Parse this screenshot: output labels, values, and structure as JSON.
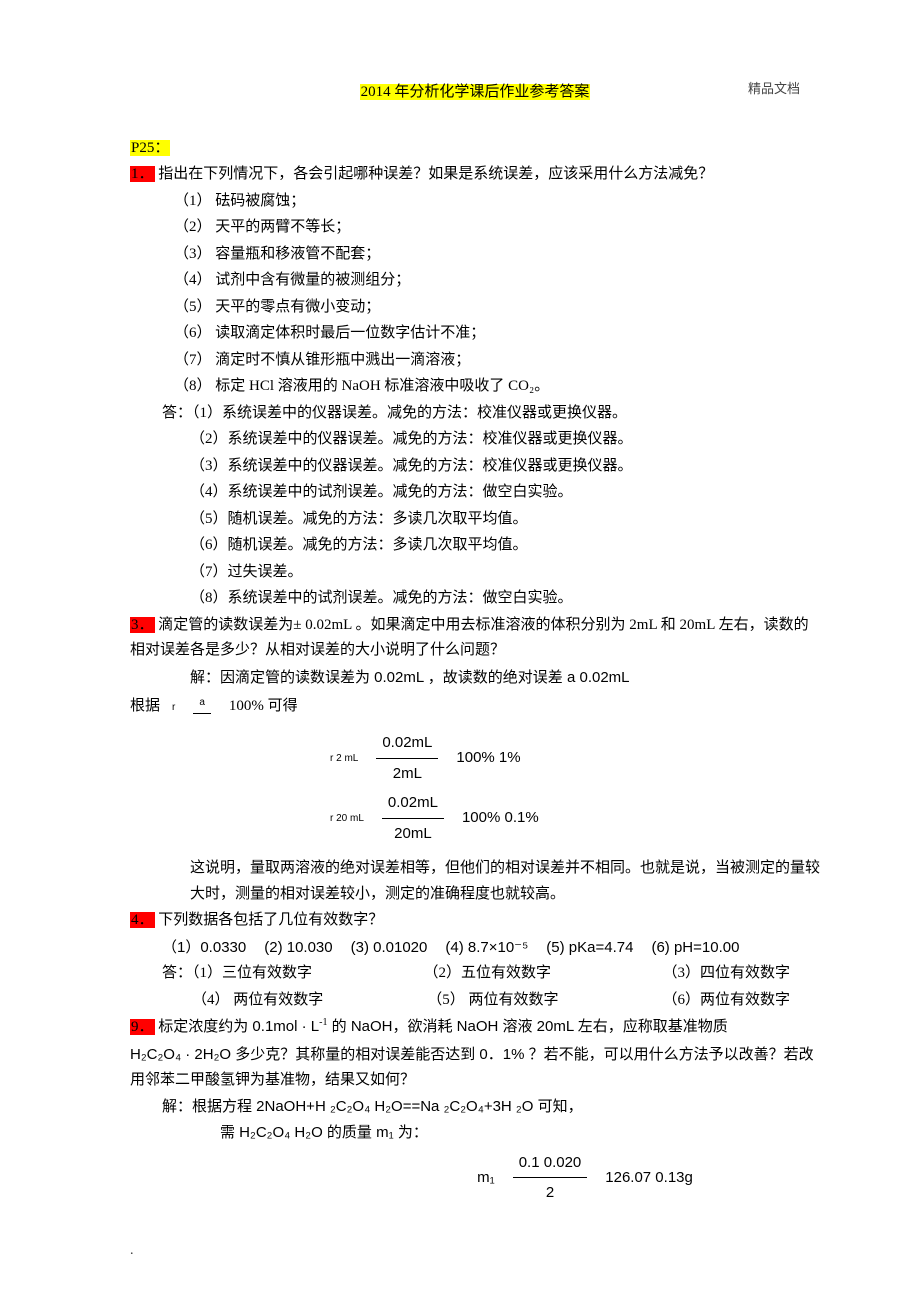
{
  "watermark": "精品文档",
  "title": "2014 年分析化学课后作业参考答案",
  "section": "P25：",
  "q1": {
    "num": "1．",
    "stem": "指出在下列情况下，各会引起哪种误差？如果是系统误差，应该采用什么方法减免？",
    "items": [
      "（1）    砝码被腐蚀；",
      "（2）    天平的两臂不等长；",
      "（3）    容量瓶和移液管不配套；",
      "（4）    试剂中含有微量的被测组分；",
      "（5）    天平的零点有微小变动；",
      "（6）    读取滴定体积时最后一位数字估计不准；",
      "（7）    滴定时不慎从锥形瓶中溅出一滴溶液；",
      "（8）    标定  HCl  溶液用的    NaOH  标准溶液中吸收了    CO₂。"
    ],
    "ans_label": "答：",
    "answers": [
      "（1）系统误差中的仪器误差。减免的方法：校准仪器或更换仪器。",
      "（2）系统误差中的仪器误差。减免的方法：校准仪器或更换仪器。",
      "（3）系统误差中的仪器误差。减免的方法：校准仪器或更换仪器。",
      "（4）系统误差中的试剂误差。减免的方法：做空白实验。",
      "（5）随机误差。减免的方法：多读几次取平均值。",
      "（6）随机误差。减免的方法：多读几次取平均值。",
      "（7）过失误差。",
      "（8）系统误差中的试剂误差。减免的方法：做空白实验。"
    ]
  },
  "q3": {
    "num": "3．",
    "stem": "滴定管的读数误差为±    0.02mL 。如果滴定中用去标准溶液的体积分别为        2mL 和  20mL  左右，读数的相对误差各是多少？从相对误差的大小说明了什么问题？",
    "sol1": "解：因滴定管的读数误差为        0.02mL ，故读数的绝对误差       a      0.02mL",
    "sol2_prefix": "根据",
    "sol2_suffix": "100% 可得",
    "row1_label": "r 2 mL",
    "row1_num": "0.02mL",
    "row1_den": "2mL",
    "row1_eq": "100%      1%",
    "row2_label": "r 20 mL",
    "row2_num": "0.02mL",
    "row2_den": "20mL",
    "row2_eq": "100%    0.1%",
    "conclusion": "这说明，量取两溶液的绝对误差相等，但他们的相对误差并不相同。也就是说，当被测定的量较大时，测量的相对误差较小，测定的准确程度也就较高。"
  },
  "q4": {
    "num": "4．",
    "stem": "下列数据各包括了几位有效数字？",
    "data": [
      "（1）0.0330",
      "(2) 10.030",
      "(3) 0.01020",
      "(4) 8.7×10⁻⁵",
      "(5) pKa=4.74",
      "(6) pH=10.00"
    ],
    "ans_label": "答：",
    "answers_row1": [
      "（1）三位有效数字",
      "（2）五位有效数字",
      "（3）四位有效数字"
    ],
    "answers_row2": [
      "（4）  两位有效数字",
      "（5）  两位有效数字",
      "（6）两位有效数字"
    ]
  },
  "q9": {
    "num": "9．",
    "stem_a": "标定浓度约为    0.1mol · L",
    "stem_b": " 的 NaOH，欲消耗  NaOH  溶液  20mL  左右，应称取基准物质",
    "stem2": "H₂C₂O₄ · 2H₂O 多少克？其称量的相对误差能否达到      0．1% ？若不能，可以用什么方法予以改善？若改用邻苯二甲酸氢钾为基准物，结果又如何？",
    "sol1": "解：根据方程    2NaOH+H ₂C₂O₄  H₂O==Na ₂C₂O₄+3H ₂O 可知，",
    "sol2": "需 H₂C₂O₄ H₂O 的质量  m₁ 为：",
    "m1_label": "m₁",
    "m1_num": "0.1   0.020",
    "m1_den": "2",
    "m1_eq": "126.07    0.13g"
  },
  "footer_dot": "."
}
